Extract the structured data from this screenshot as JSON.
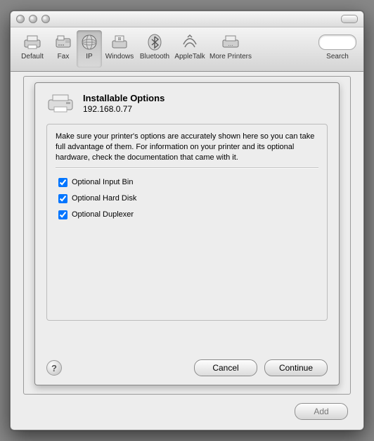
{
  "toolbar": {
    "items": [
      {
        "label": "Default"
      },
      {
        "label": "Fax"
      },
      {
        "label": "IP"
      },
      {
        "label": "Windows"
      },
      {
        "label": "Bluetooth"
      },
      {
        "label": "AppleTalk"
      },
      {
        "label": "More Printers"
      }
    ],
    "search_label": "Search"
  },
  "sheet": {
    "title": "Installable Options",
    "subtitle": "192.168.0.77",
    "instructions": "Make sure your printer's options are accurately shown here so you can take full advantage of them.  For information on your printer and its optional hardware, check the documentation that came with it.",
    "options": [
      {
        "label": "Optional Input Bin",
        "checked": true
      },
      {
        "label": "Optional Hard Disk",
        "checked": true
      },
      {
        "label": "Optional Duplexer",
        "checked": true
      }
    ],
    "help": "?",
    "cancel": "Cancel",
    "continue": "Continue"
  },
  "footer": {
    "add": "Add"
  }
}
